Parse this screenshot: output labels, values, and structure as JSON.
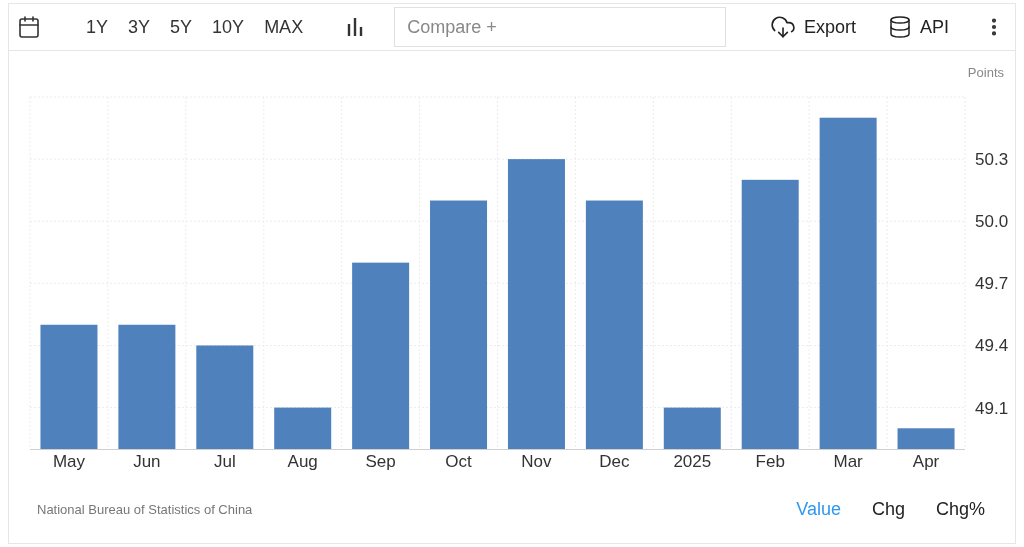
{
  "toolbar": {
    "ranges": [
      {
        "label": "1Y",
        "selected": false
      },
      {
        "label": "3Y",
        "selected": false
      },
      {
        "label": "5Y",
        "selected": false
      },
      {
        "label": "10Y",
        "selected": false
      },
      {
        "label": "MAX",
        "selected": false
      }
    ],
    "compare": {
      "placeholder": "Compare +"
    },
    "export": {
      "label": "Export"
    },
    "api": {
      "label": "API"
    }
  },
  "chart": {
    "chart_data": {
      "type": "bar",
      "ylabel": "Points",
      "categories": [
        "May",
        "Jun",
        "Jul",
        "Aug",
        "Sep",
        "Oct",
        "Nov",
        "Dec",
        "2025",
        "Feb",
        "Mar",
        "Apr"
      ],
      "grid": true,
      "series": [
        {
          "color": "#4f81bd",
          "values": [
            49.5,
            49.5,
            49.4,
            49.1,
            49.8,
            50.1,
            50.3,
            50.1,
            49.1,
            50.2,
            50.5,
            49.0
          ]
        }
      ],
      "ylim": [
        48.9,
        50.6
      ],
      "yticks": [
        {
          "value": 49.1,
          "label": "49.1"
        },
        {
          "value": 49.4,
          "label": "49.4"
        },
        {
          "value": 49.7,
          "label": "49.7"
        },
        {
          "value": 50.0,
          "label": "50.0"
        },
        {
          "value": 50.3,
          "label": "50.3"
        }
      ]
    }
  },
  "footer": {
    "source": "National Bureau of Statistics of China",
    "modes": [
      {
        "label": "Value",
        "selected": true
      },
      {
        "label": "Chg",
        "selected": false
      },
      {
        "label": "Chg%",
        "selected": false
      }
    ]
  }
}
